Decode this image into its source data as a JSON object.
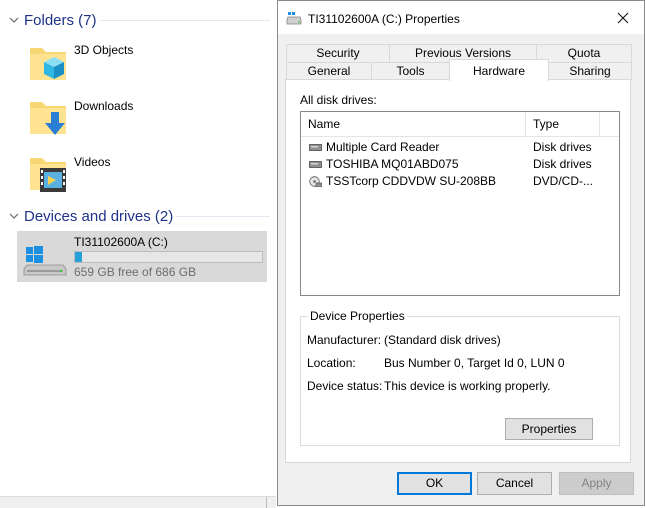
{
  "explorer": {
    "folders_header": "Folders (7)",
    "folders": [
      {
        "name": "3D Objects",
        "icon": "3d-objects-folder-icon"
      },
      {
        "name": "Downloads",
        "icon": "downloads-folder-icon"
      },
      {
        "name": "Videos",
        "icon": "videos-folder-icon"
      }
    ],
    "devices_header": "Devices and drives (2)",
    "drive": {
      "name": "TI31102600A (C:)",
      "free": "659 GB free of 686 GB",
      "used_fraction": 0.04
    }
  },
  "dialog": {
    "title": "TI31102600A (C:) Properties",
    "tabs_row1": [
      "Security",
      "Previous Versions",
      "Quota"
    ],
    "tabs_row2": [
      "General",
      "Tools",
      "Hardware",
      "Sharing"
    ],
    "active_tab": "Hardware",
    "all_disk_drives_label": "All disk drives:",
    "columns": {
      "name": "Name",
      "type": "Type"
    },
    "drives": [
      {
        "name": "Multiple Card Reader",
        "type": "Disk drives",
        "icon": "disk-drive-icon"
      },
      {
        "name": "TOSHIBA MQ01ABD075",
        "type": "Disk drives",
        "icon": "disk-drive-icon"
      },
      {
        "name": "TSSTcorp CDDVDW SU-208BB",
        "type": "DVD/CD-...",
        "icon": "dvd-drive-icon"
      }
    ],
    "device_properties": {
      "title": "Device Properties",
      "manufacturer_label": "Manufacturer:",
      "manufacturer_value": "(Standard disk drives)",
      "location_label": "Location:",
      "location_value": "Bus Number 0, Target Id 0, LUN 0",
      "status_label": "Device status:",
      "status_value": "This device is working properly.",
      "properties_button": "Properties"
    },
    "buttons": {
      "ok": "OK",
      "cancel": "Cancel",
      "apply": "Apply"
    }
  },
  "colors": {
    "group_header": "#1e3287",
    "accent": "#0078d7",
    "progress_fill": "#26a0da",
    "selected_tile": "#d9d9d9"
  }
}
